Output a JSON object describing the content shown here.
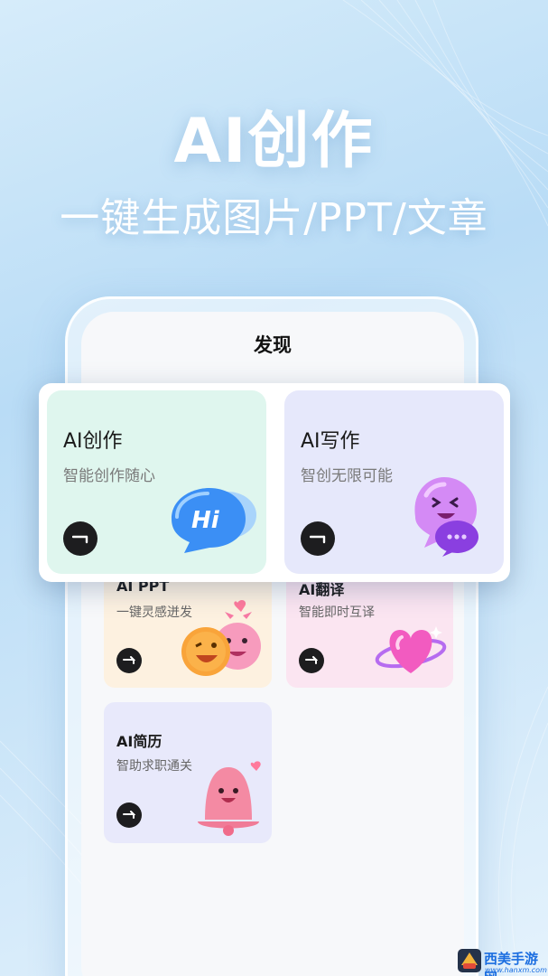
{
  "hero": {
    "title": "AI创作",
    "subtitle": "一键生成图片/PPT/文章"
  },
  "screen": {
    "title": "发现"
  },
  "featured_cards": [
    {
      "title": "AI创作",
      "subtitle": "智能创作随心",
      "bg": "#dff6ee",
      "icon": "hi-chat-bubble-icon"
    },
    {
      "title": "AI写作",
      "subtitle": "智创无限可能",
      "bg": "#e6e8fb",
      "icon": "purple-chat-ghost-icon"
    }
  ],
  "grid_cards": [
    {
      "title": "AI PPT",
      "subtitle": "一键灵感迸发",
      "bg": "#fdf1e0",
      "icon": "emoji-faces-icon"
    },
    {
      "title": "AI翻译",
      "subtitle": "智能即时互译",
      "bg": "#fbe5f1",
      "icon": "heart-planet-icon"
    },
    {
      "title": "AI简历",
      "subtitle": "智助求职通关",
      "bg": "#e8e9fb",
      "icon": "pink-bell-icon"
    }
  ],
  "watermark": {
    "brand": "西美手游网",
    "url": "www.hanxm.com"
  }
}
